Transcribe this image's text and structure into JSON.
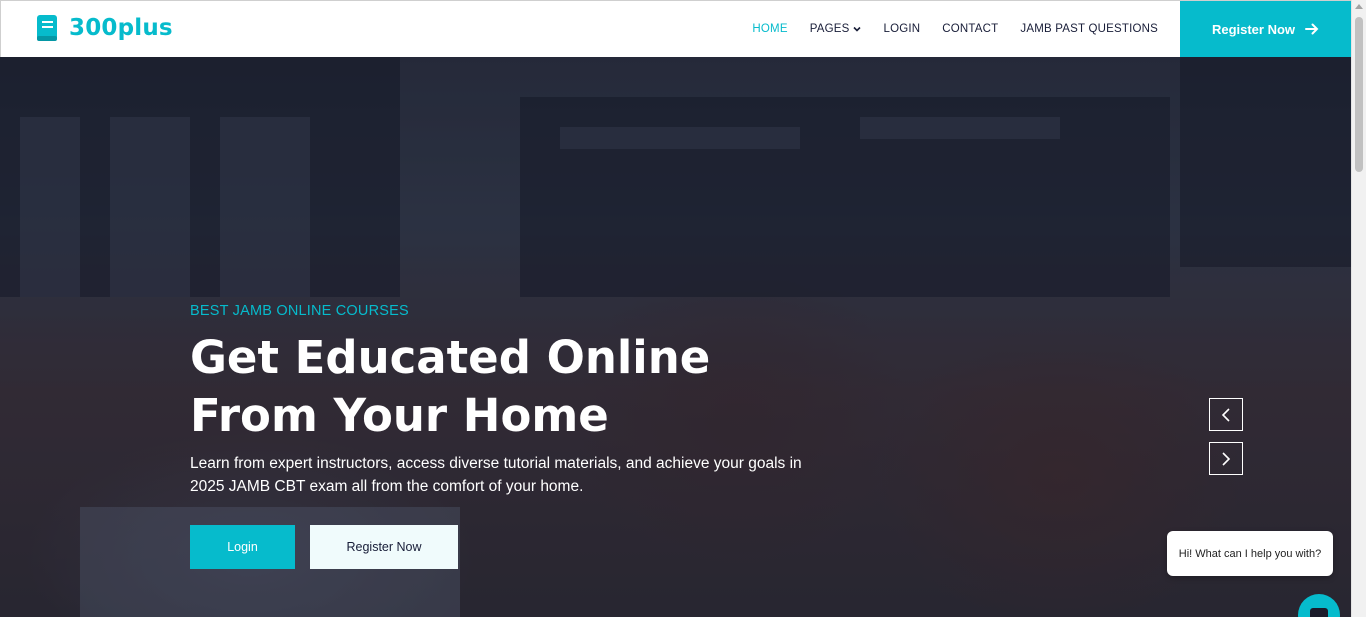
{
  "brand": {
    "name": "300plus",
    "icon": "book-icon"
  },
  "nav": {
    "items": [
      {
        "label": "HOME",
        "active": true
      },
      {
        "label": "PAGES",
        "dropdown": true
      },
      {
        "label": "LOGIN"
      },
      {
        "label": "CONTACT"
      },
      {
        "label": "JAMB PAST QUESTIONS"
      }
    ],
    "register_label": "Register Now",
    "register_icon": "arrow-right-icon"
  },
  "hero": {
    "eyebrow": "BEST JAMB ONLINE COURSES",
    "headline": "Get Educated Online From Your Home",
    "lead": "Learn from expert instructors, access diverse tutorial materials, and achieve your goals in 2025 JAMB CBT exam all from the comfort of your home.",
    "login_label": "Login",
    "register_label": "Register Now"
  },
  "carousel": {
    "prev_icon": "chevron-left-icon",
    "next_icon": "chevron-right-icon"
  },
  "chat": {
    "greeting": "Hi! What can I help you with?",
    "icon": "chat-icon"
  },
  "colors": {
    "accent": "#06BBCC",
    "dark": "#181d38",
    "light_button": "#F0FBFC"
  }
}
